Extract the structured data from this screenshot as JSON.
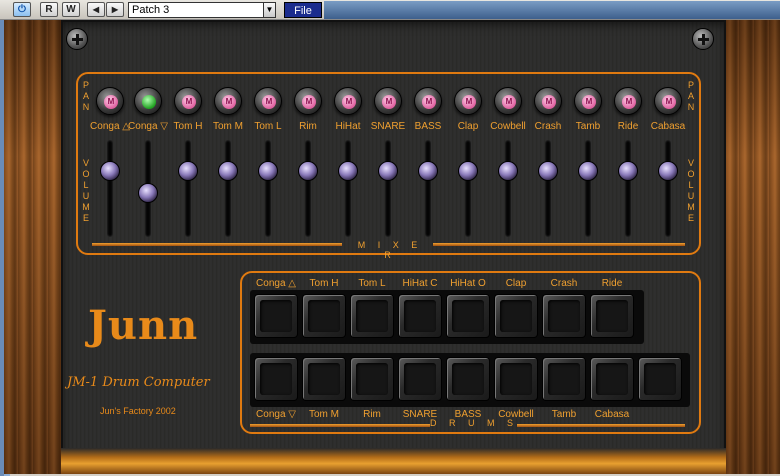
{
  "host": {
    "record_label": "R",
    "write_label": "W",
    "prev_label": "◀",
    "next_label": "▶",
    "patch_name": "Patch 3",
    "file_label": "File"
  },
  "mixer": {
    "title": "M I X E R",
    "pan_label": "P A N",
    "volume_label": "V O L U M E",
    "mute_glyph": "M",
    "channels": [
      {
        "label": "Conga △",
        "mute": "on",
        "volume": 0.68
      },
      {
        "label": "Conga ▽",
        "mute": "green",
        "volume": 0.45
      },
      {
        "label": "Tom H",
        "mute": "on",
        "volume": 0.68
      },
      {
        "label": "Tom M",
        "mute": "on",
        "volume": 0.68
      },
      {
        "label": "Tom L",
        "mute": "on",
        "volume": 0.68
      },
      {
        "label": "Rim",
        "mute": "on",
        "volume": 0.68
      },
      {
        "label": "HiHat",
        "mute": "on",
        "volume": 0.68
      },
      {
        "label": "SNARE",
        "mute": "on",
        "volume": 0.68
      },
      {
        "label": "BASS",
        "mute": "on",
        "volume": 0.68
      },
      {
        "label": "Clap",
        "mute": "on",
        "volume": 0.68
      },
      {
        "label": "Cowbell",
        "mute": "on",
        "volume": 0.68
      },
      {
        "label": "Crash",
        "mute": "on",
        "volume": 0.68
      },
      {
        "label": "Tamb",
        "mute": "on",
        "volume": 0.68
      },
      {
        "label": "Ride",
        "mute": "on",
        "volume": 0.68
      },
      {
        "label": "Cabasa",
        "mute": "on",
        "volume": 0.68
      }
    ]
  },
  "brand": {
    "logo": "Junn",
    "model": "JM-1 Drum Computer",
    "factory": "Jun's Factory 2002"
  },
  "drums": {
    "title": "D R U M S",
    "top_pads": [
      "Conga △",
      "Tom H",
      "Tom L",
      "HiHat C",
      "HiHat O",
      "Clap",
      "Crash",
      "Ride"
    ],
    "bottom_pads": [
      "Conga ▽",
      "Tom M",
      "Rim",
      "SNARE",
      "BASS",
      "Cowbell",
      "Tamb",
      "Cabasa"
    ]
  },
  "colors": {
    "accent": "#e07a10",
    "label": "#f0a030",
    "mute_led": "#e060a0",
    "mute_led_green": "#20a020"
  }
}
